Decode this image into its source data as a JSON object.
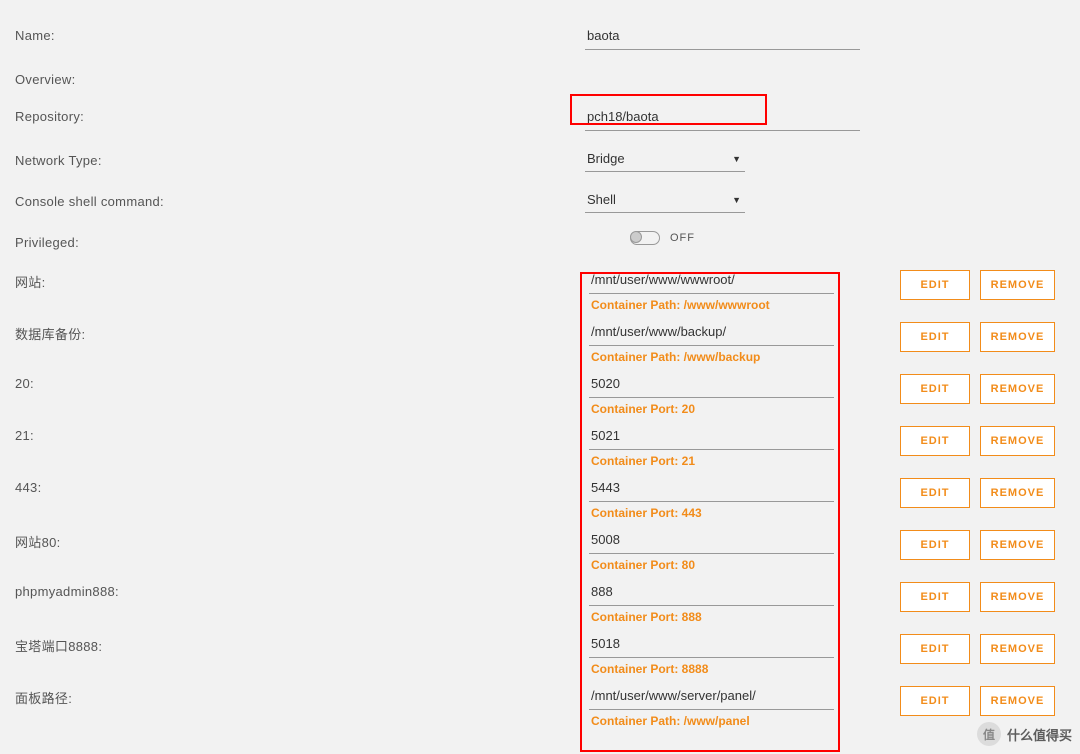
{
  "fields": {
    "name_label": "Name:",
    "name_value": "baota",
    "overview_label": "Overview:",
    "repository_label": "Repository:",
    "repository_value": "pch18/baota",
    "network_type_label": "Network Type:",
    "network_type_value": "Bridge",
    "console_label": "Console shell command:",
    "console_value": "Shell",
    "privileged_label": "Privileged:",
    "privileged_state": "OFF"
  },
  "buttons": {
    "edit": "EDIT",
    "remove": "REMOVE"
  },
  "mappings": [
    {
      "label": "网站:",
      "value": "/mnt/user/www/wwwroot/",
      "hint": "Container Path: /www/wwwroot"
    },
    {
      "label": "数据库备份:",
      "value": "/mnt/user/www/backup/",
      "hint": "Container Path: /www/backup"
    },
    {
      "label": "20:",
      "value": "5020",
      "hint": "Container Port: 20"
    },
    {
      "label": "21:",
      "value": "5021",
      "hint": "Container Port: 21"
    },
    {
      "label": "443:",
      "value": "5443",
      "hint": "Container Port: 443"
    },
    {
      "label": "网站80:",
      "value": "5008",
      "hint": "Container Port: 80"
    },
    {
      "label": "phpmyadmin888:",
      "value": "888",
      "hint": "Container Port: 888"
    },
    {
      "label": "宝塔端口8888:",
      "value": "5018",
      "hint": "Container Port: 8888"
    },
    {
      "label": "面板路径:",
      "value": "/mnt/user/www/server/panel/",
      "hint": "Container Path: /www/panel"
    }
  ],
  "watermark": "什么值得买"
}
